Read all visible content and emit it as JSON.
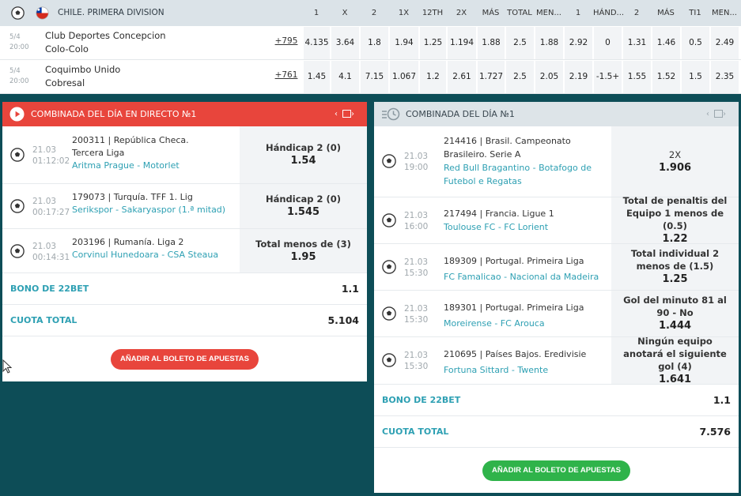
{
  "top_table": {
    "league": "CHILE. PRIMERA DIVISION",
    "columns": [
      "1",
      "X",
      "2",
      "1X",
      "12TH",
      "2X",
      "MÁS DE",
      "TOTAL",
      "MEN...",
      "1",
      "HÁND...",
      "2",
      "MÁS DE",
      "TI1",
      "MEN..."
    ],
    "matches": [
      {
        "date": "5/4",
        "time": "20:00",
        "home": "Club Deportes Concepcion",
        "away": "Colo-Colo",
        "more": "+795",
        "odds": [
          "4.135",
          "3.64",
          "1.8",
          "1.94",
          "1.25",
          "1.194",
          "1.88",
          "2.5",
          "1.88",
          "2.92",
          "0",
          "1.31",
          "1.46",
          "0.5",
          "2.49"
        ]
      },
      {
        "date": "5/4",
        "time": "20:00",
        "home": "Coquimbo Unido",
        "away": "Cobresal",
        "more": "+761",
        "odds": [
          "1.45",
          "4.1",
          "7.15",
          "1.067",
          "1.2",
          "2.61",
          "1.727",
          "2.5",
          "2.05",
          "2.19",
          "-1.5+",
          "1.55",
          "1.52",
          "1.5",
          "2.35"
        ]
      }
    ]
  },
  "live_panel": {
    "title": "COMBINADA DEL DÍA EN DIRECTO №1",
    "events": [
      {
        "date": "21.03",
        "time": "01:12:02",
        "event": "200311 | República Checa. Tercera Liga",
        "home": "Aritma Prague",
        "away": "- Motorlet",
        "bet": "Hándicap 2 (0)",
        "odd": "1.54"
      },
      {
        "date": "21.03",
        "time": "00:17:27",
        "event": "179073 | Turquía. TFF 1. Lig",
        "home": "Serikspor",
        "away": "- Sakaryaspor (1.ª mitad)",
        "bet": "Hándicap 2 (0)",
        "odd": "1.545"
      },
      {
        "date": "21.03",
        "time": "00:14:31",
        "event": "203196 | Rumanía. Liga 2",
        "home": "Corvinul Hunedoara",
        "away": "- CSA Steaua",
        "bet": "Total menos de (3)",
        "odd": "1.95"
      }
    ],
    "bonus_label": "BONO DE 22BET",
    "bonus_value": "1.1",
    "total_label": "CUOTA TOTAL",
    "total_value": "5.104",
    "add_button": "AÑADIR AL BOLETO DE APUESTAS"
  },
  "pre_panel": {
    "title": "COMBINADA DEL DÍA №1",
    "events": [
      {
        "date": "21.03",
        "time": "19:00",
        "event": "214416 | Brasil. Campeonato Brasileiro. Serie A",
        "home": "Red Bull Bragantino",
        "away": "- Botafogo de Futebol e Regatas",
        "bet": "2X",
        "odd": "1.906"
      },
      {
        "date": "21.03",
        "time": "16:00",
        "event": "217494 | Francia. Ligue 1",
        "home": "Toulouse FC",
        "away": "- FC Lorient",
        "bet": "Total de penaltis del Equipo 1 menos de (0.5)",
        "odd": "1.22"
      },
      {
        "date": "21.03",
        "time": "15:30",
        "event": "189309 | Portugal. Primeira Liga",
        "home": "FC Famalicao",
        "away": "- Nacional da Madeira",
        "bet": "Total individual 2 menos de (1.5)",
        "odd": "1.25"
      },
      {
        "date": "21.03",
        "time": "15:30",
        "event": "189301 | Portugal. Primeira Liga",
        "home": "Moreirense",
        "away": "- FC Arouca",
        "bet": "Gol del minuto 81 al 90 - No",
        "odd": "1.444"
      },
      {
        "date": "21.03",
        "time": "15:30",
        "event": "210695 | Países Bajos. Eredivisie",
        "home": "Fortuna Sittard",
        "away": "- Twente",
        "bet": "Ningún equipo anotará el siguiente gol (4)",
        "odd": "1.641"
      }
    ],
    "bonus_label": "BONO DE 22BET",
    "bonus_value": "1.1",
    "total_label": "CUOTA TOTAL",
    "total_value": "7.576",
    "add_button": "AÑADIR AL BOLETO DE APUESTAS"
  },
  "colors": {
    "live_header": "#e8453c",
    "add_live": "#e8453c",
    "add_pre": "#2fb34a",
    "link": "#2ea0b3",
    "page_bg": "#0d4d57"
  }
}
